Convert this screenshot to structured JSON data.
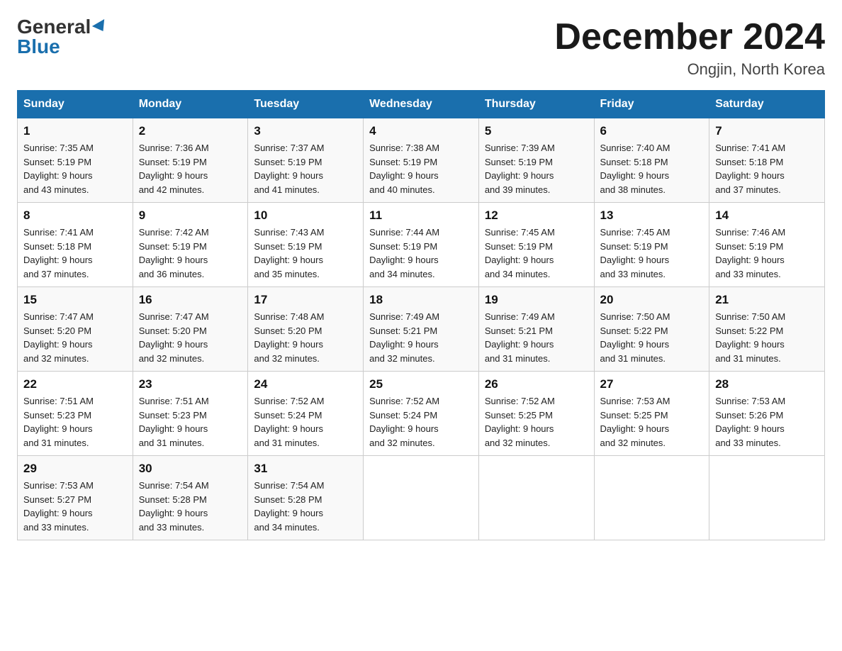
{
  "header": {
    "logo_general": "General",
    "logo_blue": "Blue",
    "month_title": "December 2024",
    "location": "Ongjin, North Korea"
  },
  "days_of_week": [
    "Sunday",
    "Monday",
    "Tuesday",
    "Wednesday",
    "Thursday",
    "Friday",
    "Saturday"
  ],
  "weeks": [
    [
      {
        "day": "1",
        "sunrise": "7:35 AM",
        "sunset": "5:19 PM",
        "daylight": "9 hours and 43 minutes."
      },
      {
        "day": "2",
        "sunrise": "7:36 AM",
        "sunset": "5:19 PM",
        "daylight": "9 hours and 42 minutes."
      },
      {
        "day": "3",
        "sunrise": "7:37 AM",
        "sunset": "5:19 PM",
        "daylight": "9 hours and 41 minutes."
      },
      {
        "day": "4",
        "sunrise": "7:38 AM",
        "sunset": "5:19 PM",
        "daylight": "9 hours and 40 minutes."
      },
      {
        "day": "5",
        "sunrise": "7:39 AM",
        "sunset": "5:19 PM",
        "daylight": "9 hours and 39 minutes."
      },
      {
        "day": "6",
        "sunrise": "7:40 AM",
        "sunset": "5:18 PM",
        "daylight": "9 hours and 38 minutes."
      },
      {
        "day": "7",
        "sunrise": "7:41 AM",
        "sunset": "5:18 PM",
        "daylight": "9 hours and 37 minutes."
      }
    ],
    [
      {
        "day": "8",
        "sunrise": "7:41 AM",
        "sunset": "5:18 PM",
        "daylight": "9 hours and 37 minutes."
      },
      {
        "day": "9",
        "sunrise": "7:42 AM",
        "sunset": "5:19 PM",
        "daylight": "9 hours and 36 minutes."
      },
      {
        "day": "10",
        "sunrise": "7:43 AM",
        "sunset": "5:19 PM",
        "daylight": "9 hours and 35 minutes."
      },
      {
        "day": "11",
        "sunrise": "7:44 AM",
        "sunset": "5:19 PM",
        "daylight": "9 hours and 34 minutes."
      },
      {
        "day": "12",
        "sunrise": "7:45 AM",
        "sunset": "5:19 PM",
        "daylight": "9 hours and 34 minutes."
      },
      {
        "day": "13",
        "sunrise": "7:45 AM",
        "sunset": "5:19 PM",
        "daylight": "9 hours and 33 minutes."
      },
      {
        "day": "14",
        "sunrise": "7:46 AM",
        "sunset": "5:19 PM",
        "daylight": "9 hours and 33 minutes."
      }
    ],
    [
      {
        "day": "15",
        "sunrise": "7:47 AM",
        "sunset": "5:20 PM",
        "daylight": "9 hours and 32 minutes."
      },
      {
        "day": "16",
        "sunrise": "7:47 AM",
        "sunset": "5:20 PM",
        "daylight": "9 hours and 32 minutes."
      },
      {
        "day": "17",
        "sunrise": "7:48 AM",
        "sunset": "5:20 PM",
        "daylight": "9 hours and 32 minutes."
      },
      {
        "day": "18",
        "sunrise": "7:49 AM",
        "sunset": "5:21 PM",
        "daylight": "9 hours and 32 minutes."
      },
      {
        "day": "19",
        "sunrise": "7:49 AM",
        "sunset": "5:21 PM",
        "daylight": "9 hours and 31 minutes."
      },
      {
        "day": "20",
        "sunrise": "7:50 AM",
        "sunset": "5:22 PM",
        "daylight": "9 hours and 31 minutes."
      },
      {
        "day": "21",
        "sunrise": "7:50 AM",
        "sunset": "5:22 PM",
        "daylight": "9 hours and 31 minutes."
      }
    ],
    [
      {
        "day": "22",
        "sunrise": "7:51 AM",
        "sunset": "5:23 PM",
        "daylight": "9 hours and 31 minutes."
      },
      {
        "day": "23",
        "sunrise": "7:51 AM",
        "sunset": "5:23 PM",
        "daylight": "9 hours and 31 minutes."
      },
      {
        "day": "24",
        "sunrise": "7:52 AM",
        "sunset": "5:24 PM",
        "daylight": "9 hours and 31 minutes."
      },
      {
        "day": "25",
        "sunrise": "7:52 AM",
        "sunset": "5:24 PM",
        "daylight": "9 hours and 32 minutes."
      },
      {
        "day": "26",
        "sunrise": "7:52 AM",
        "sunset": "5:25 PM",
        "daylight": "9 hours and 32 minutes."
      },
      {
        "day": "27",
        "sunrise": "7:53 AM",
        "sunset": "5:25 PM",
        "daylight": "9 hours and 32 minutes."
      },
      {
        "day": "28",
        "sunrise": "7:53 AM",
        "sunset": "5:26 PM",
        "daylight": "9 hours and 33 minutes."
      }
    ],
    [
      {
        "day": "29",
        "sunrise": "7:53 AM",
        "sunset": "5:27 PM",
        "daylight": "9 hours and 33 minutes."
      },
      {
        "day": "30",
        "sunrise": "7:54 AM",
        "sunset": "5:28 PM",
        "daylight": "9 hours and 33 minutes."
      },
      {
        "day": "31",
        "sunrise": "7:54 AM",
        "sunset": "5:28 PM",
        "daylight": "9 hours and 34 minutes."
      },
      null,
      null,
      null,
      null
    ]
  ],
  "labels": {
    "sunrise_prefix": "Sunrise: ",
    "sunset_prefix": "Sunset: ",
    "daylight_prefix": "Daylight: "
  }
}
